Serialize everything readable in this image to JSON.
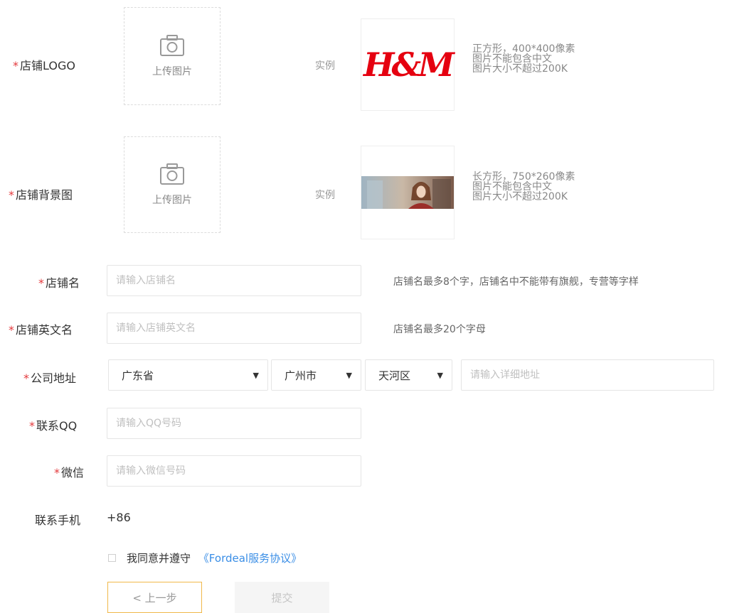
{
  "required_mark": "*",
  "logo": {
    "label": "店铺LOGO",
    "upload_text": "上传图片",
    "example_label": "实例",
    "example_logo_text": "H&M",
    "hints": [
      "正方形，400*400像素",
      "图片不能包含中文",
      "图片大小不超过200K"
    ]
  },
  "background": {
    "label": "店铺背景图",
    "upload_text": "上传图片",
    "example_label": "实例",
    "hints": [
      "长方形，750*260像素",
      "图片不能包含中文",
      "图片大小不超过200K"
    ]
  },
  "store_name": {
    "label": "店铺名",
    "placeholder": "请输入店铺名",
    "hint": "店铺名最多8个字，店铺名中不能带有旗舰，专营等字样"
  },
  "store_name_en": {
    "label": "店铺英文名",
    "placeholder": "请输入店铺英文名",
    "hint": "店铺名最多20个字母"
  },
  "address": {
    "label": "公司地址",
    "province": "广东省",
    "city": "广州市",
    "district": "天河区",
    "detail_placeholder": "请输入详细地址"
  },
  "qq": {
    "label": "联系QQ",
    "placeholder": "请输入QQ号码"
  },
  "wechat": {
    "label": "微信",
    "placeholder": "请输入微信号码"
  },
  "phone": {
    "label": "联系手机",
    "prefix": "+86"
  },
  "agreement": {
    "text": "我同意并遵守",
    "link": "《Fordeal服务协议》"
  },
  "buttons": {
    "prev": "< 上一步",
    "submit": "提交"
  },
  "colors": {
    "required": "#e4393c",
    "link": "#3a8ee6",
    "prev_border": "#f0b84a",
    "hm_red": "#e50010"
  }
}
